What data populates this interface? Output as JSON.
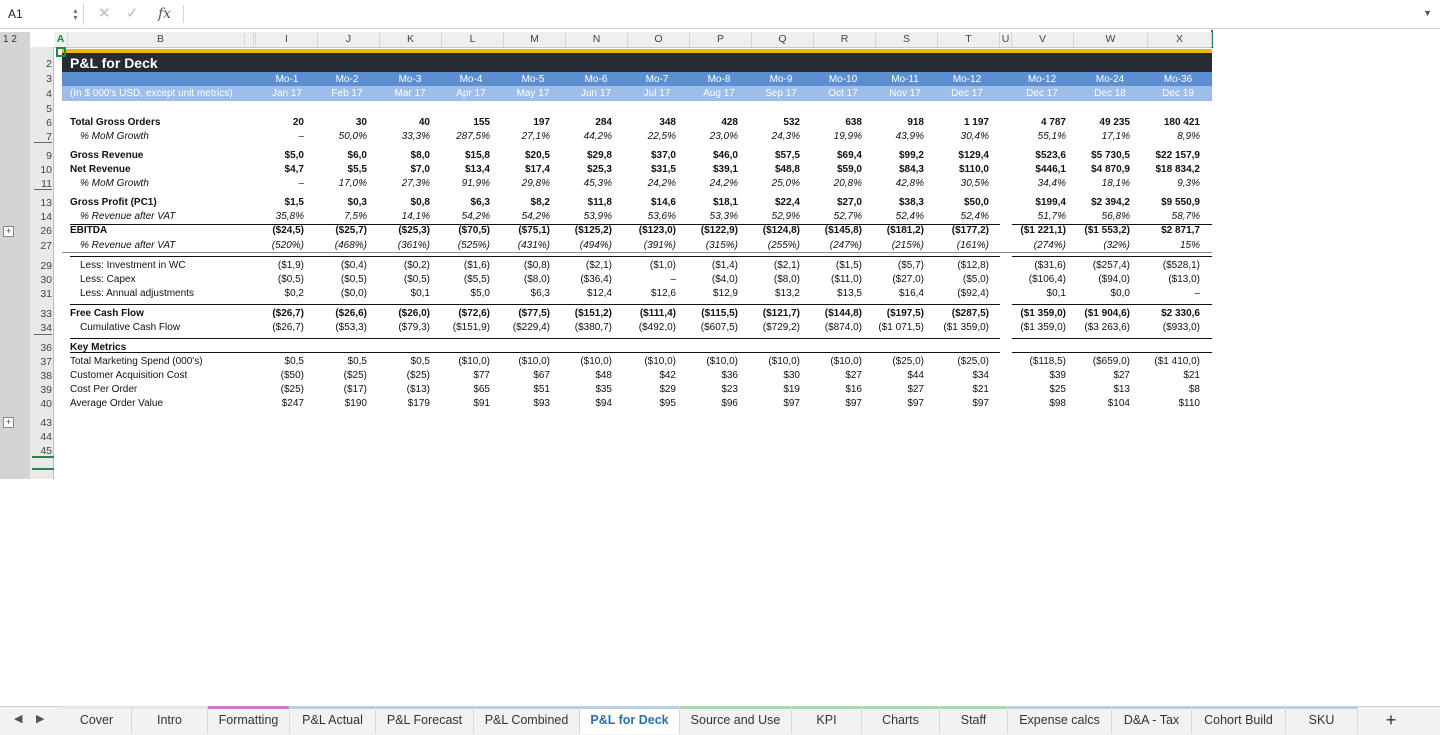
{
  "formula_bar": {
    "name_box": "A1",
    "fx": "fx",
    "formula": ""
  },
  "outline_levels": "1 2",
  "columns": {
    "A": "A",
    "B": "B",
    "I": "I",
    "J": "J",
    "K": "K",
    "L": "L",
    "M": "M",
    "N": "N",
    "O": "O",
    "P": "P",
    "Q": "Q",
    "R": "R",
    "S": "S",
    "T": "T",
    "U": "U",
    "V": "V",
    "W": "W",
    "X": "X"
  },
  "rows": [
    "2",
    "3",
    "4",
    "5",
    "6",
    "7",
    "8",
    "9",
    "10",
    "11",
    "12",
    "13",
    "14",
    "26",
    "27",
    "28",
    "29",
    "30",
    "31",
    "32",
    "33",
    "34",
    "35",
    "36",
    "37",
    "38",
    "39",
    "40",
    "43",
    "44",
    "45"
  ],
  "sheet": {
    "title": "P&L for Deck",
    "units_label": "(In $ 000's USD, except unit metrics)",
    "months": [
      "Mo-1",
      "Mo-2",
      "Mo-3",
      "Mo-4",
      "Mo-5",
      "Mo-6",
      "Mo-7",
      "Mo-8",
      "Mo-9",
      "Mo-10",
      "Mo-11",
      "Mo-12",
      "Mo-12",
      "Mo-24",
      "Mo-36"
    ],
    "dates": [
      "Jan 17",
      "Feb 17",
      "Mar 17",
      "Apr 17",
      "May 17",
      "Jun 17",
      "Jul 17",
      "Aug 17",
      "Sep 17",
      "Oct 17",
      "Nov 17",
      "Dec 17",
      "Dec 17",
      "Dec 18",
      "Dec 19"
    ],
    "labels": {
      "r6": "Total Gross Orders",
      "r7": "% MoM Growth",
      "r9": "Gross Revenue",
      "r10": "Net Revenue",
      "r11": "% MoM Growth",
      "r13": "Gross Profit (PC1)",
      "r14": "% Revenue after VAT",
      "r26": "EBITDA",
      "r27": "% Revenue after VAT",
      "r29": "Less: Investment in WC",
      "r30": "Less: Capex",
      "r31": "Less: Annual adjustments",
      "r33": "Free Cash Flow",
      "r34": "Cumulative Cash Flow",
      "r36": "Key Metrics",
      "r37": "Total Marketing Spend (000's)",
      "r38": "Customer Acquisition Cost",
      "r39": "Cost Per Order",
      "r40": "Average Order Value"
    },
    "data": {
      "r6": [
        "20",
        "30",
        "40",
        "155",
        "197",
        "284",
        "348",
        "428",
        "532",
        "638",
        "918",
        "1 197",
        "4 787",
        "49 235",
        "180 421"
      ],
      "r7": [
        "–",
        "50,0%",
        "33,3%",
        "287,5%",
        "27,1%",
        "44,2%",
        "22,5%",
        "23,0%",
        "24,3%",
        "19,9%",
        "43,9%",
        "30,4%",
        "55,1%",
        "17,1%",
        "8,9%"
      ],
      "r9": [
        "$5,0",
        "$6,0",
        "$8,0",
        "$15,8",
        "$20,5",
        "$29,8",
        "$37,0",
        "$46,0",
        "$57,5",
        "$69,4",
        "$99,2",
        "$129,4",
        "$523,6",
        "$5 730,5",
        "$22 157,9"
      ],
      "r10": [
        "$4,7",
        "$5,5",
        "$7,0",
        "$13,4",
        "$17,4",
        "$25,3",
        "$31,5",
        "$39,1",
        "$48,8",
        "$59,0",
        "$84,3",
        "$110,0",
        "$446,1",
        "$4 870,9",
        "$18 834,2"
      ],
      "r11": [
        "–",
        "17,0%",
        "27,3%",
        "91,9%",
        "29,8%",
        "45,3%",
        "24,2%",
        "24,2%",
        "25,0%",
        "20,8%",
        "42,8%",
        "30,5%",
        "34,4%",
        "18,1%",
        "9,3%"
      ],
      "r13": [
        "$1,5",
        "$0,3",
        "$0,8",
        "$6,3",
        "$8,2",
        "$11,8",
        "$14,6",
        "$18,1",
        "$22,4",
        "$27,0",
        "$38,3",
        "$50,0",
        "$199,4",
        "$2 394,2",
        "$9 550,9"
      ],
      "r14": [
        "35,8%",
        "7,5%",
        "14,1%",
        "54,2%",
        "54,2%",
        "53,9%",
        "53,6%",
        "53,3%",
        "52,9%",
        "52,7%",
        "52,4%",
        "52,4%",
        "51,7%",
        "56,8%",
        "58,7%"
      ],
      "r26": [
        "($24,5)",
        "($25,7)",
        "($25,3)",
        "($70,5)",
        "($75,1)",
        "($125,2)",
        "($123,0)",
        "($122,9)",
        "($124,8)",
        "($145,8)",
        "($181,2)",
        "($177,2)",
        "($1 221,1)",
        "($1 553,2)",
        "$2 871,7"
      ],
      "r27": [
        "(520%)",
        "(468%)",
        "(361%)",
        "(525%)",
        "(431%)",
        "(494%)",
        "(391%)",
        "(315%)",
        "(255%)",
        "(247%)",
        "(215%)",
        "(161%)",
        "(274%)",
        "(32%)",
        "15%"
      ],
      "r29": [
        "($1,9)",
        "($0,4)",
        "($0,2)",
        "($1,6)",
        "($0,8)",
        "($2,1)",
        "($1,0)",
        "($1,4)",
        "($2,1)",
        "($1,5)",
        "($5,7)",
        "($12,8)",
        "($31,6)",
        "($257,4)",
        "($528,1)"
      ],
      "r30": [
        "($0,5)",
        "($0,5)",
        "($0,5)",
        "($5,5)",
        "($8,0)",
        "($36,4)",
        "–",
        "($4,0)",
        "($8,0)",
        "($11,0)",
        "($27,0)",
        "($5,0)",
        "($106,4)",
        "($94,0)",
        "($13,0)"
      ],
      "r31": [
        "$0,2",
        "($0,0)",
        "$0,1",
        "$5,0",
        "$6,3",
        "$12,4",
        "$12,6",
        "$12,9",
        "$13,2",
        "$13,5",
        "$16,4",
        "($92,4)",
        "$0,1",
        "$0,0",
        "–"
      ],
      "r33": [
        "($26,7)",
        "($26,6)",
        "($26,0)",
        "($72,6)",
        "($77,5)",
        "($151,2)",
        "($111,4)",
        "($115,5)",
        "($121,7)",
        "($144,8)",
        "($197,5)",
        "($287,5)",
        "($1 359,0)",
        "($1 904,6)",
        "$2 330,6"
      ],
      "r34": [
        "($26,7)",
        "($53,3)",
        "($79,3)",
        "($151,9)",
        "($229,4)",
        "($380,7)",
        "($492,0)",
        "($607,5)",
        "($729,2)",
        "($874,0)",
        "($1 071,5)",
        "($1 359,0)",
        "($1 359,0)",
        "($3 263,6)",
        "($933,0)"
      ],
      "r37": [
        "$0,5",
        "$0,5",
        "$0,5",
        "($10,0)",
        "($10,0)",
        "($10,0)",
        "($10,0)",
        "($10,0)",
        "($10,0)",
        "($10,0)",
        "($25,0)",
        "($25,0)",
        "($118,5)",
        "($659,0)",
        "($1 410,0)"
      ],
      "r38": [
        "($50)",
        "($25)",
        "($25)",
        "$77",
        "$67",
        "$48",
        "$42",
        "$36",
        "$30",
        "$27",
        "$44",
        "$34",
        "$39",
        "$27",
        "$21"
      ],
      "r39": [
        "($25)",
        "($17)",
        "($13)",
        "$65",
        "$51",
        "$35",
        "$29",
        "$23",
        "$19",
        "$16",
        "$27",
        "$21",
        "$25",
        "$13",
        "$8"
      ],
      "r40": [
        "$247",
        "$190",
        "$179",
        "$91",
        "$93",
        "$94",
        "$95",
        "$96",
        "$97",
        "$97",
        "$97",
        "$97",
        "$98",
        "$104",
        "$110"
      ]
    }
  },
  "tabs": [
    {
      "label": "Cover",
      "color": "#e6e6e6"
    },
    {
      "label": "Intro",
      "color": "#e6e6e6"
    },
    {
      "label": "Formatting",
      "color": "#c47ec4"
    },
    {
      "label": "P&L Actual",
      "color": "#b7d0ea"
    },
    {
      "label": "P&L Forecast",
      "color": "#b7d0ea"
    },
    {
      "label": "P&L Combined",
      "color": "#b7d0ea"
    },
    {
      "label": "P&L for Deck",
      "color": "#b7d0ea"
    },
    {
      "label": "Source and Use",
      "color": "#a8dba8"
    },
    {
      "label": "KPI",
      "color": "#a8dba8"
    },
    {
      "label": "Charts",
      "color": "#a8dba8"
    },
    {
      "label": "Staff",
      "color": "#a8dba8"
    },
    {
      "label": "Expense calcs",
      "color": "#b7d0ea"
    },
    {
      "label": "D&A - Tax",
      "color": "#b7d0ea"
    },
    {
      "label": "Cohort Build",
      "color": "#b7d0ea"
    },
    {
      "label": "SKU",
      "color": "#b7d0ea"
    }
  ],
  "active_tab": "P&L for Deck",
  "add_sheet": "+",
  "colors": {
    "title_band": "#252a33",
    "gold": "#f2b705",
    "blue": "#5b8fd1",
    "light_blue": "#9ebde8",
    "active_tab_text": "#2a6fb0"
  }
}
